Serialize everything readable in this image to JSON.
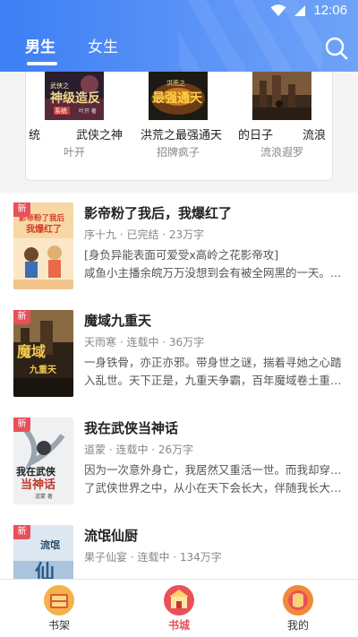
{
  "status_bar": {
    "time": "12:06"
  },
  "header": {
    "tabs": [
      {
        "label": "男生",
        "active": true
      },
      {
        "label": "女生",
        "active": false
      }
    ],
    "accent": "#4a88f6"
  },
  "featured": {
    "covers": [
      {
        "text_top": "武侠之",
        "text_big": "神级造反",
        "text_badge": "系统",
        "author_mark": "叶开 著"
      },
      {
        "text_top": "洪荒之",
        "text_big": "最强通天"
      },
      {
        "text_big": ""
      }
    ],
    "titles": [
      "统",
      "武侠之神",
      "洪荒之最强通天",
      "的日子",
      "流浪"
    ],
    "authors": [
      "叶开",
      "招牌疯子",
      "流浪遐罗"
    ]
  },
  "books": [
    {
      "badge": "新",
      "title": "影帝粉了我后，我爆红了",
      "meta": "序十九 · 已完结 · 23万字",
      "desc": [
        "[身负异能表面可爱受x高岭之花影帝攻]",
        "咸鱼小主播余皖万万没想到会有被全网黑的一天。..."
      ],
      "cover_text": [
        "影帝粉了我后",
        "我爆红了"
      ]
    },
    {
      "badge": "新",
      "title": "魔域九重天",
      "meta": "天雨寒 · 连载中 · 36万字",
      "desc": [
        "一身铁骨，亦正亦邪。带身世之谜，揣着寻她之心踏",
        "入乱世。天下正是，九重天争霸，百年魔域卷土重来..."
      ],
      "cover_text": [
        "魔域",
        "九重天"
      ]
    },
    {
      "badge": "新",
      "title": "我在武侠当神话",
      "meta": "道蒙 · 连载中 · 26万字",
      "desc": [
        "因为一次意外身亡，我居然又重活一世。而我却穿越到",
        "了武侠世界之中，从小在天下会长大，伴随我长大的..."
      ],
      "cover_text": [
        "我在武侠",
        "当神话",
        "道蒙 著"
      ]
    },
    {
      "badge": "新",
      "title": "流氓仙厨",
      "meta": "果子仙宴 · 连载中 · 134万字",
      "desc": [
        "",
        ""
      ],
      "cover_text": [
        "流氓",
        "仙"
      ]
    }
  ],
  "bottom_nav": [
    {
      "label": "书架",
      "icon": "bookshelf-icon",
      "active": false
    },
    {
      "label": "书城",
      "icon": "bookstore-icon",
      "active": true
    },
    {
      "label": "我的",
      "icon": "profile-icon",
      "active": false
    }
  ],
  "colors": {
    "badge": "#e8515a",
    "active_nav": "#e8515a",
    "header": "#4a88f6"
  }
}
